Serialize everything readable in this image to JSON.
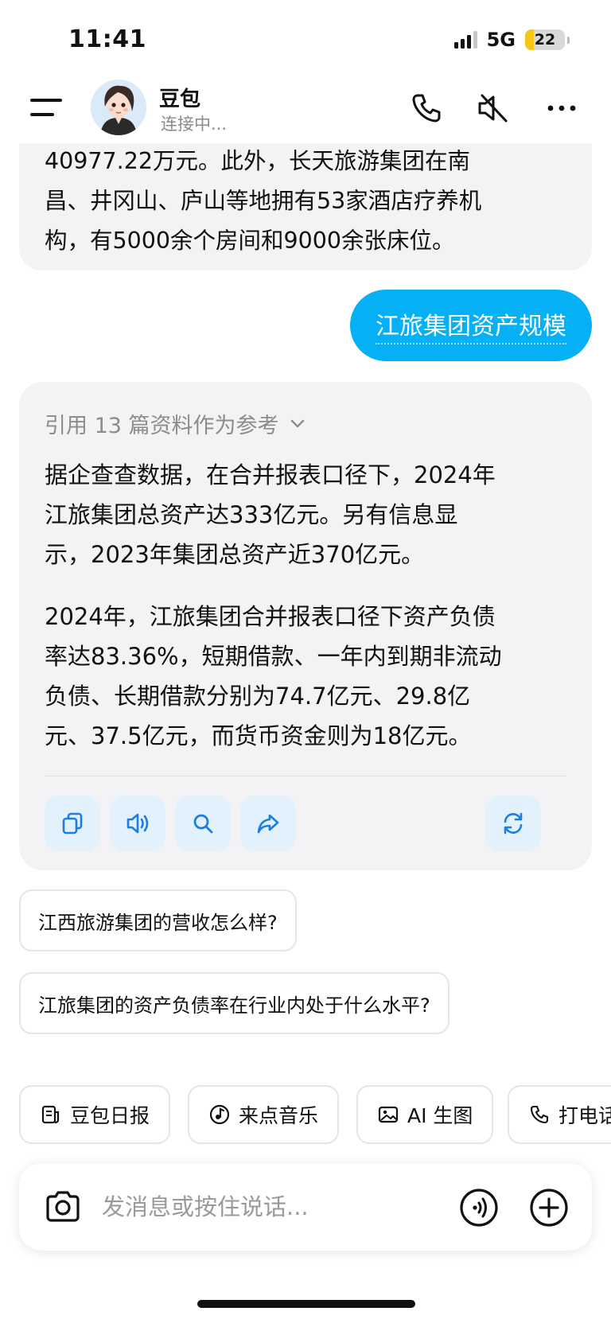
{
  "status_bar": {
    "time": "11:41",
    "network": "5G",
    "battery": "22",
    "battery_level": 0.22
  },
  "header": {
    "bot_name": "豆包",
    "bot_status": "连接中..."
  },
  "icons": {
    "menu": "menu-icon",
    "avatar": "avatar",
    "phone": "phone-icon",
    "mute": "mute-icon",
    "more": "more-icon",
    "copy": "copy-icon",
    "speaker": "speaker-icon",
    "search": "search-icon",
    "share": "share-icon",
    "refresh": "refresh-icon",
    "camera": "camera-icon",
    "voice": "voice-icon",
    "plus": "plus-icon"
  },
  "messages": {
    "previous_ai_tail": [
      "40977.22万元。此外，长天旅游集团在南",
      "昌、井冈山、庐山等地拥有53家酒店疗养机",
      "构，有5000余个房间和9000余张床位。"
    ],
    "user_query": "江旅集团资产规模",
    "ai_reply": {
      "references": "引用 13 篇资料作为参考",
      "paragraphs": [
        [
          "据企查查数据，在合并报表口径下，2024年",
          "江旅集团总资产达333亿元。另有信息显",
          "示，2023年集团总资产近370亿元。"
        ],
        [
          "2024年，江旅集团合并报表口径下资产负债",
          "率达83.36%，短期借款、一年内到期非流动",
          "负债、长期借款分别为74.7亿元、29.8亿",
          "元、37.5亿元，而货币资金则为18亿元。"
        ]
      ]
    }
  },
  "suggestions": [
    "江西旅游集团的营收怎么样?",
    "江旅集团的资产负债率在行业内处于什么水平?"
  ],
  "chips": [
    {
      "label": "豆包日报",
      "icon": "news-icon"
    },
    {
      "label": "来点音乐",
      "icon": "music-icon"
    },
    {
      "label": "AI 生图",
      "icon": "image-icon"
    },
    {
      "label": "打电话",
      "icon": "phone-icon"
    }
  ],
  "input": {
    "placeholder": "发消息或按住说话..."
  },
  "colors": {
    "accent": "#06b0f5",
    "bubble_bg": "#f3f3f5",
    "action_bg": "#e3f1fc",
    "action_icon": "#1a7fe0",
    "battery": "#f5c518"
  }
}
